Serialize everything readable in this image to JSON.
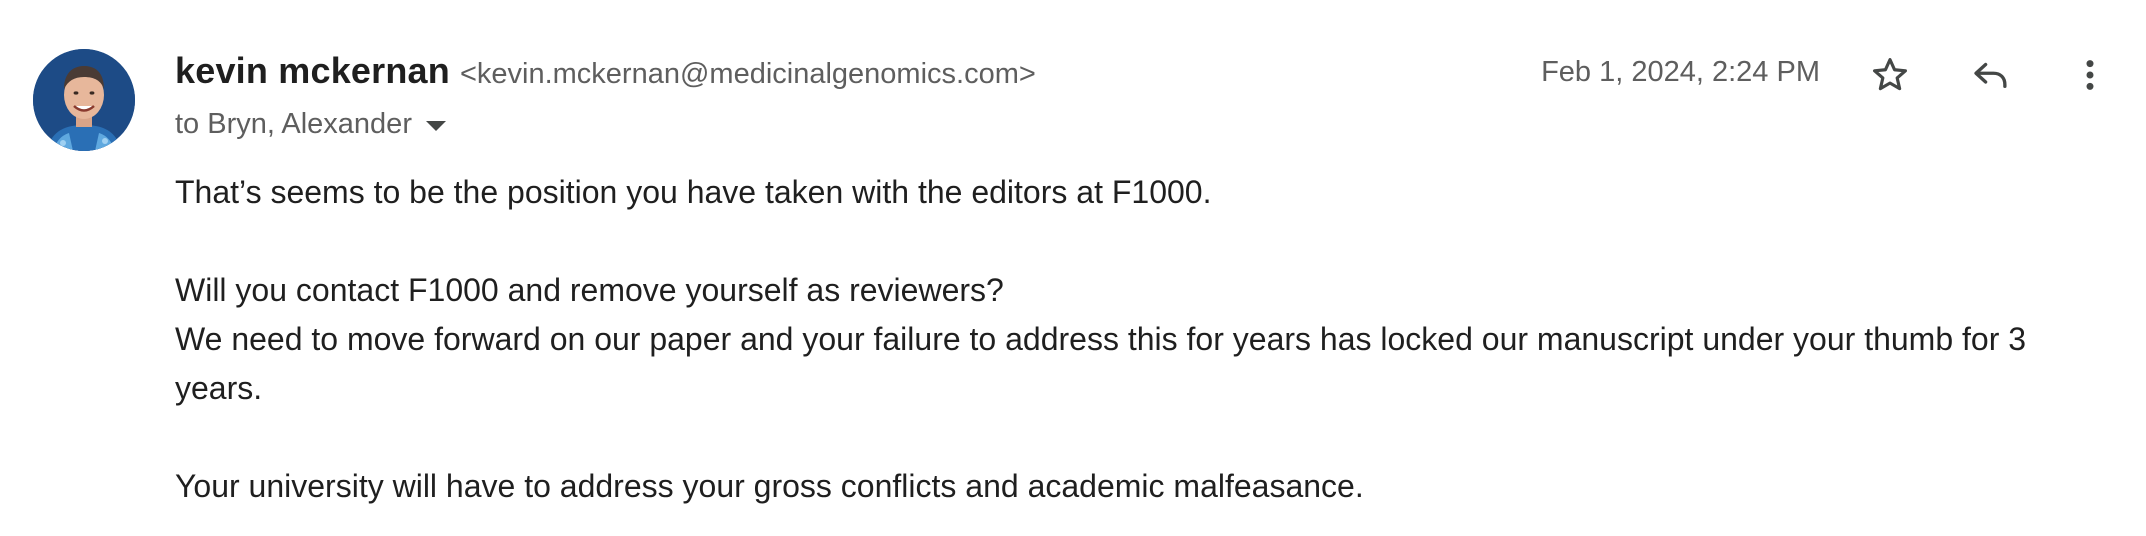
{
  "sender": {
    "name": "kevin mckernan",
    "email": "<kevin.mckernan@medicinalgenomics.com>"
  },
  "recipients": {
    "label": "to Bryn, Alexander"
  },
  "timestamp": "Feb 1, 2024, 2:24 PM",
  "actions": {
    "star_icon": "star-outline-icon",
    "reply_icon": "reply-icon",
    "more_icon": "more-vert-icon"
  },
  "body": {
    "paragraph_1": "That’s seems to be the position you have taken with the editors at F1000.",
    "paragraph_2_line_1": "Will you contact F1000 and remove yourself as reviewers?",
    "paragraph_2_line_2": "We need to move forward on our paper and your failure to address this for years has locked our manuscript under your thumb for 3 years.",
    "paragraph_3": "Your university will have to address your gross conflicts and academic malfeasance."
  },
  "colors": {
    "primary_text": "#1f1f1f",
    "secondary_text": "#5e5e5e",
    "icon": "#444746",
    "avatar_background": "#1f4e87"
  }
}
